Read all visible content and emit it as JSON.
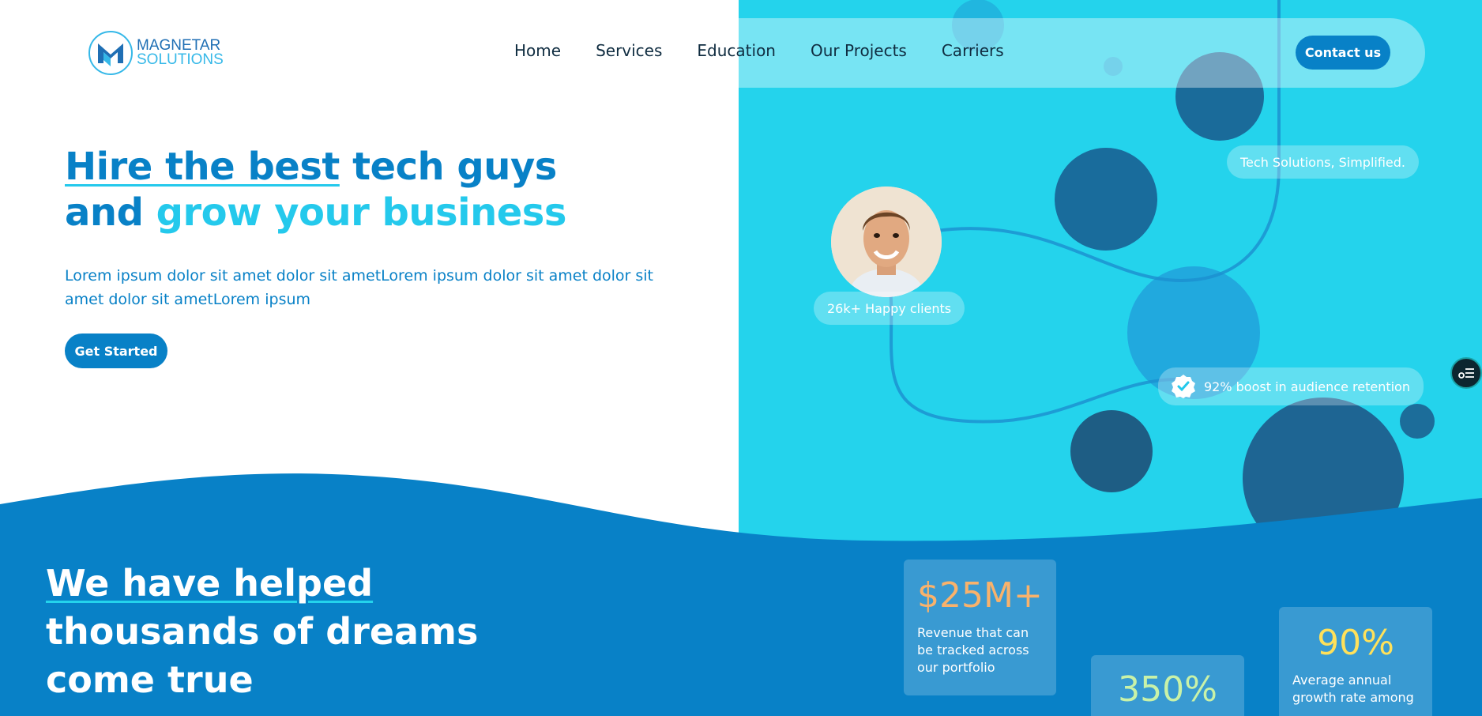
{
  "brand": {
    "name_line1": "MAGNETAR",
    "name_line2": "SOLUTIONS",
    "logo_icon": "m-logo-icon"
  },
  "nav": {
    "links": [
      "Home",
      "Services",
      "Education",
      "Our Projects",
      "Carriers"
    ],
    "contact_label": "Contact us"
  },
  "hero": {
    "title_part1": "Hire the best",
    "title_part2": " tech guys",
    "title_part3": "and ",
    "title_part4": "grow your business",
    "description": "Lorem ipsum dolor sit amet dolor sit ametLorem ipsum dolor sit amet dolor sit amet dolor sit ametLorem ipsum",
    "cta_label": "Get Started"
  },
  "panel": {
    "tagline": "Tech Solutions, Simplified.",
    "clients_label": "26k+ Happy clients",
    "boost_label": "92% boost in audience retention",
    "check_icon": "check-badge-icon"
  },
  "stats": {
    "title_part1": "We have helped",
    "title_part2": "thousands of dreams",
    "title_part3": "come true",
    "cards": [
      {
        "value": "$25M+",
        "description": "Revenue that can be tracked across our portfolio"
      },
      {
        "value": "350%",
        "description": ""
      },
      {
        "value": "90%",
        "description": "Average annual growth rate among"
      }
    ]
  },
  "colors": {
    "primary": "#0881c7",
    "cyan": "#24d3ec",
    "dark_circle": "#1a6b9a"
  }
}
